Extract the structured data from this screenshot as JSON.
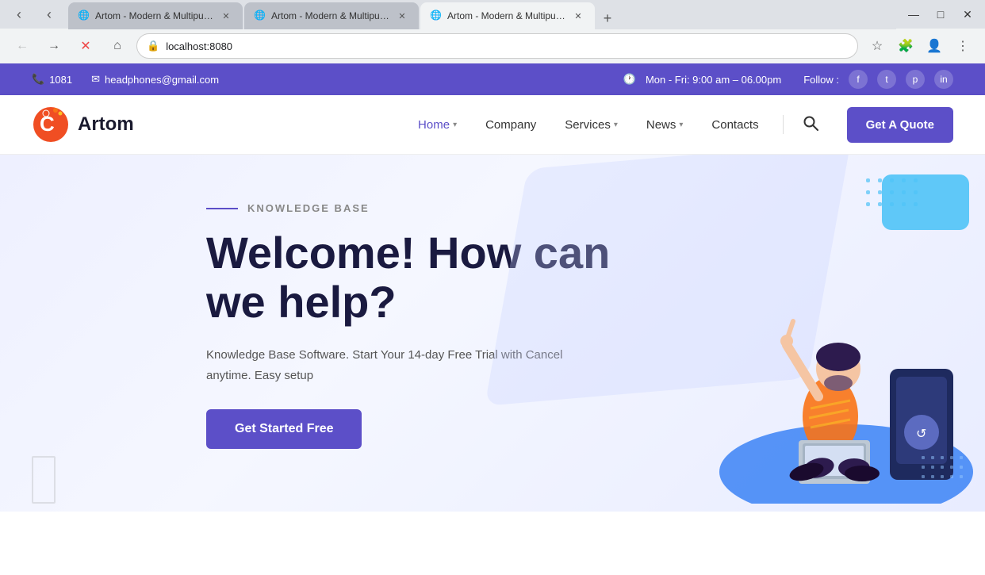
{
  "browser": {
    "tabs": [
      {
        "id": 1,
        "title": "Artom - Modern & Multipur...",
        "active": false,
        "favicon": "🌐"
      },
      {
        "id": 2,
        "title": "Artom - Modern & Multipur...",
        "active": false,
        "favicon": "🌐"
      },
      {
        "id": 3,
        "title": "Artom - Modern & Multipur...",
        "active": true,
        "favicon": "🌐"
      }
    ],
    "address": "localhost:8080",
    "loading": true
  },
  "infobar": {
    "phone_icon": "📞",
    "phone": "1081",
    "email_icon": "✉",
    "email": "headphones@gmail.com",
    "clock_icon": "🕐",
    "hours": "Mon - Fri: 9:00 am – 06.00pm",
    "follow_label": "Follow :",
    "social": [
      "f",
      "t",
      "p",
      "in"
    ]
  },
  "nav": {
    "logo_text": "Artom",
    "links": [
      {
        "label": "Home",
        "has_dropdown": true,
        "active": true
      },
      {
        "label": "Company",
        "has_dropdown": false,
        "active": false
      },
      {
        "label": "Services",
        "has_dropdown": true,
        "active": false
      },
      {
        "label": "News",
        "has_dropdown": true,
        "active": false
      },
      {
        "label": "Contacts",
        "has_dropdown": false,
        "active": false
      }
    ],
    "quote_btn": "Get A Quote"
  },
  "hero": {
    "tag": "KNOWLEDGE BASE",
    "title_line1": "Welcome! How can",
    "title_line2": "we help?",
    "description": "Knowledge Base Software. Start Your 14-day Free Trial with Cancel anytime. Easy setup",
    "cta": "Get Started Free"
  }
}
